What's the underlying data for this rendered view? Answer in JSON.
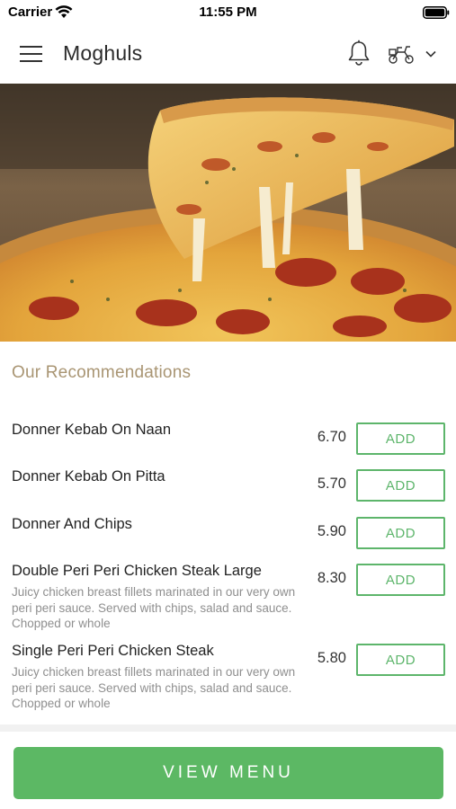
{
  "status": {
    "carrier": "Carrier",
    "time": "11:55 PM"
  },
  "header": {
    "title": "Moghuls"
  },
  "hero": {
    "subject": "pizza-with-cheese-pull"
  },
  "recommendations": {
    "title": "Our Recommendations",
    "add_label": "ADD",
    "items": [
      {
        "name": "Donner Kebab On Naan",
        "price": "6.70",
        "description": ""
      },
      {
        "name": "Donner Kebab On Pitta",
        "price": "5.70",
        "description": ""
      },
      {
        "name": "Donner And Chips",
        "price": "5.90",
        "description": ""
      },
      {
        "name": "Double Peri Peri Chicken Steak Large",
        "price": "8.30",
        "description": "Juicy chicken breast fillets marinated in our very own peri peri sauce. Served with chips, salad and sauce. Chopped or whole"
      },
      {
        "name": "Single Peri Peri Chicken Steak",
        "price": "5.80",
        "description": "Juicy chicken breast fillets marinated in our very own peri peri sauce. Served with chips, salad and sauce. Chopped or whole"
      }
    ]
  },
  "footer": {
    "view_menu_label": "VIEW MENU"
  },
  "colors": {
    "accent_green": "#5cb864",
    "section_title": "#a99573",
    "description_text": "#8f8f8f"
  },
  "icons": {
    "menu": "hamburger-menu-icon",
    "notifications": "bell-icon",
    "delivery": "delivery-scooter-icon",
    "dropdown": "chevron-down-icon"
  }
}
